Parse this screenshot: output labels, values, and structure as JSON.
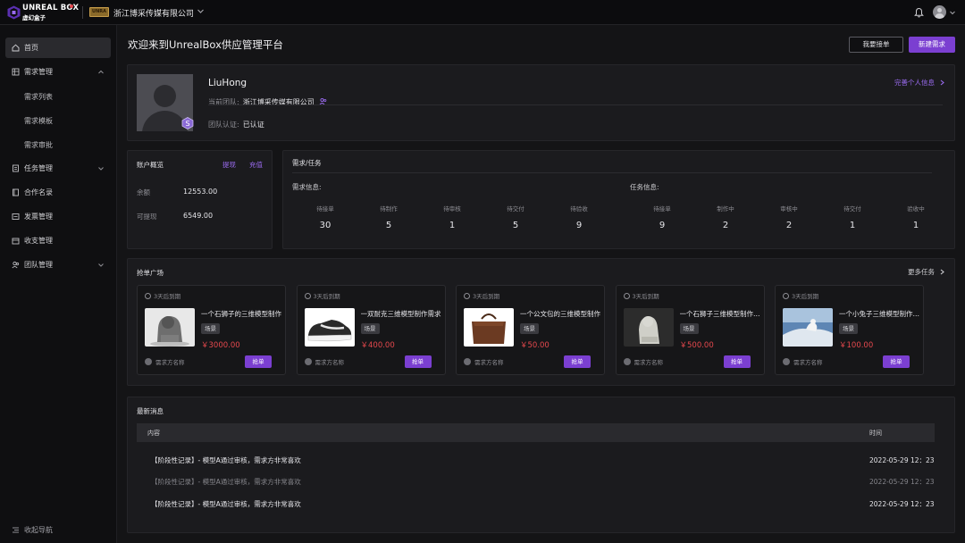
{
  "brand": {
    "name_en": "UNREAL BOX",
    "name_cn": "虚幻盒子",
    "company_badge": "UNRA"
  },
  "header": {
    "company": "浙江博采传媒有限公司"
  },
  "sidebar": {
    "items": [
      {
        "label": "首页",
        "icon": "home-icon"
      },
      {
        "label": "需求管理",
        "icon": "list-icon"
      },
      {
        "label": "需求列表"
      },
      {
        "label": "需求模板"
      },
      {
        "label": "需求审批"
      },
      {
        "label": "任务管理",
        "icon": "task-icon"
      },
      {
        "label": "合作名录",
        "icon": "book-icon"
      },
      {
        "label": "发票管理",
        "icon": "invoice-icon"
      },
      {
        "label": "收支管理",
        "icon": "wallet-icon"
      },
      {
        "label": "团队管理",
        "icon": "team-icon"
      }
    ],
    "collapse_label": "收起导航"
  },
  "main": {
    "title": "欢迎来到UnrealBox供应管理平台",
    "btn_my": "我要接单",
    "btn_new": "新建需求"
  },
  "profile": {
    "name": "LiuHong",
    "team_label": "当前团队:",
    "team_value": "浙江博采传媒有限公司",
    "cert_label": "团队认证:",
    "cert_value": "已认证",
    "link": "完善个人信息",
    "badge": "S"
  },
  "account": {
    "title": "账户概览",
    "link_withdraw": "提现",
    "link_recharge": "充值",
    "balance_label": "余额",
    "balance_value": "12553.00",
    "available_label": "可提现",
    "available_value": "6549.00"
  },
  "tasks": {
    "title": "需求/任务",
    "demand_info": "需求信息:",
    "task_info": "任务信息:",
    "demand_stats": [
      {
        "label": "待接单",
        "value": "30"
      },
      {
        "label": "待制作",
        "value": "5"
      },
      {
        "label": "待审核",
        "value": "1"
      },
      {
        "label": "待交付",
        "value": "5"
      },
      {
        "label": "待验收",
        "value": "9"
      }
    ],
    "task_stats": [
      {
        "label": "待接单",
        "value": "9"
      },
      {
        "label": "制作中",
        "value": "2"
      },
      {
        "label": "审核中",
        "value": "2"
      },
      {
        "label": "待交付",
        "value": "1"
      },
      {
        "label": "验收中",
        "value": "1"
      }
    ]
  },
  "grab": {
    "title": "抢单广场",
    "more": "更多任务",
    "cards": [
      {
        "deadline": "3天后到期",
        "title": "一个石狮子的三维模型制作",
        "tag": "场景",
        "price": "￥3000.00",
        "requester": "需求方名称",
        "btn": "抢单"
      },
      {
        "deadline": "3天后到期",
        "title": "一双耐克三维模型制作需求",
        "tag": "场景",
        "price": "￥400.00",
        "requester": "需求方名称",
        "btn": "抢单"
      },
      {
        "deadline": "3天后到期",
        "title": "一个公文包的三维模型制作",
        "tag": "场景",
        "price": "￥50.00",
        "requester": "需求方名称",
        "btn": "抢单"
      },
      {
        "deadline": "3天后到期",
        "title": "一个石狮子三维模型制作需求",
        "tag": "场景",
        "price": "￥500.00",
        "requester": "需求方名称",
        "btn": "抢单"
      },
      {
        "deadline": "3天后到期",
        "title": "一个小兔子三维模型制作需求",
        "tag": "场景",
        "price": "￥100.00",
        "requester": "需求方名称",
        "btn": "抢单"
      }
    ]
  },
  "messages": {
    "title": "最新消息",
    "col_content": "内容",
    "col_time": "时间",
    "rows": [
      {
        "text": "【阶段性记录】- 模型A通过审核，需求方非常喜欢",
        "time": "2022-05-29 12：23"
      },
      {
        "text": "【阶段性记录】- 模型A通过审核，需求方非常喜欢",
        "time": "2022-05-29 12：23"
      },
      {
        "text": "【阶段性记录】- 模型A通过审核，需求方非常喜欢",
        "time": "2022-05-29 12：23"
      }
    ]
  },
  "colors": {
    "accent": "#7b3fd1",
    "price": "#e5484d",
    "link": "#9a6bf0"
  }
}
